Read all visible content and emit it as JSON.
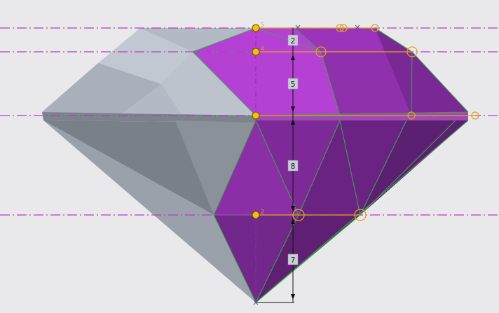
{
  "colors": {
    "background": "#e9e9ec",
    "datum_line": "#b43cc8",
    "purple_light": "#b63fd6",
    "purple_mid": "#8a2fa6",
    "purple_dark": "#5e1f70",
    "grey_light": "#b7bec9",
    "grey_mid": "#8c929b",
    "grey_dark": "#6f747c",
    "edge": "#3aa84a",
    "handle": "#f2c300",
    "sketch": "#e1a21a"
  },
  "datum_labels": [
    "5",
    "4",
    "",
    "2"
  ],
  "dimensions": {
    "d1": "2",
    "d2": "5",
    "d3": "8",
    "d4": "7"
  }
}
